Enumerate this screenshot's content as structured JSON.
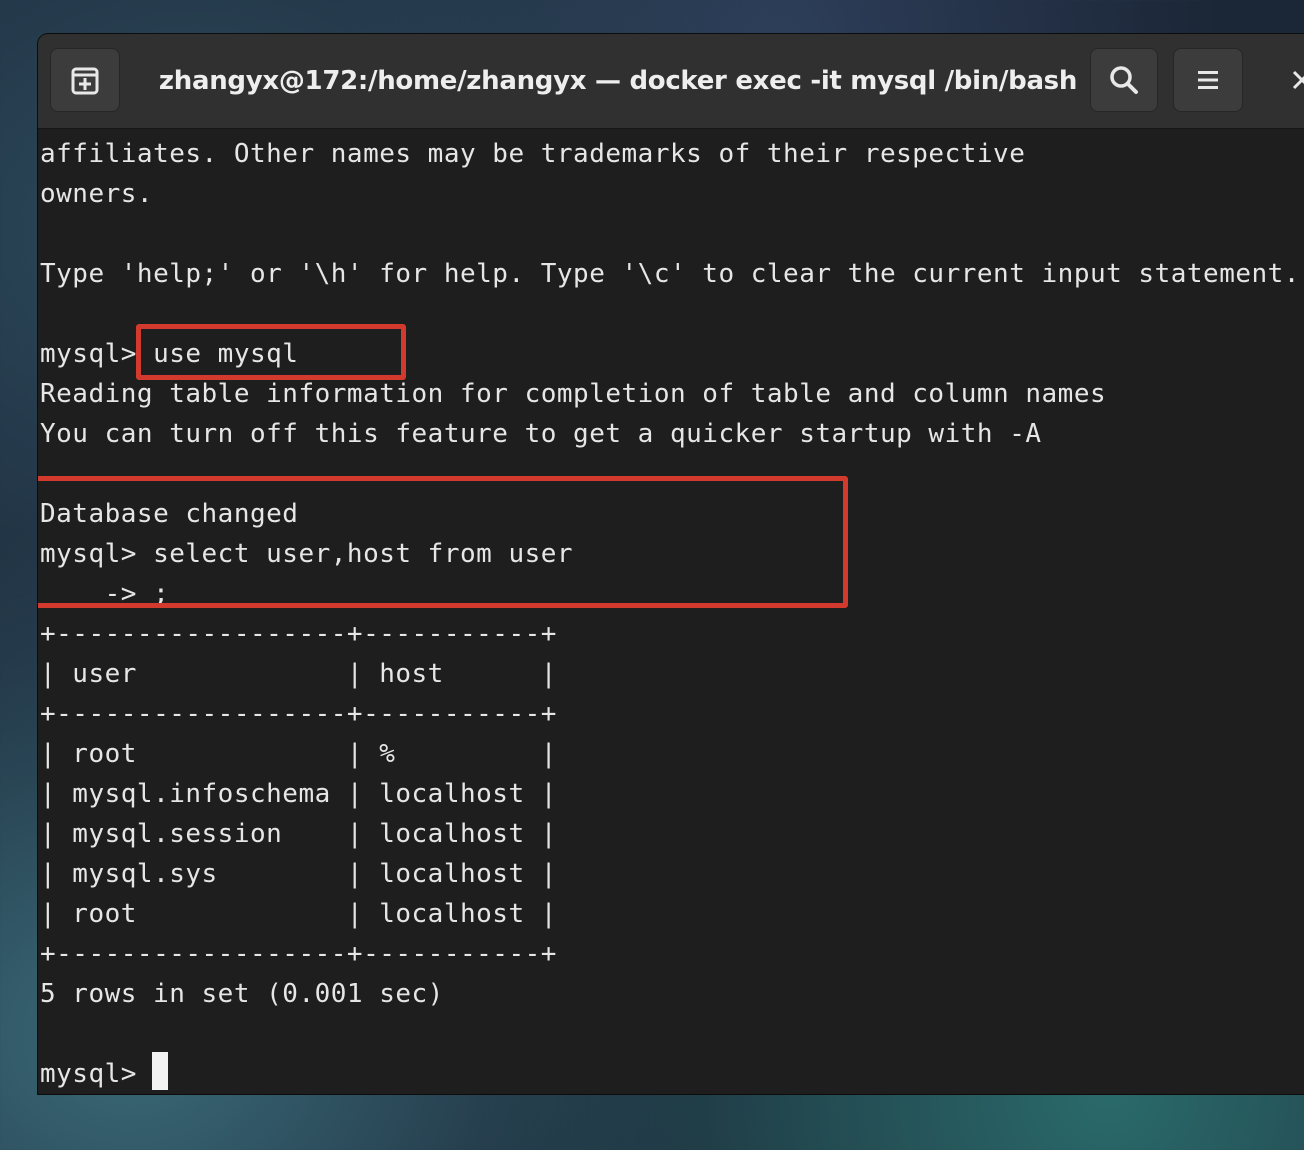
{
  "window": {
    "title": "zhangyx@172:/home/zhangyx — docker exec -it mysql /bin/bash"
  },
  "titlebar": {
    "new_tab_icon": "new-tab-icon",
    "search_icon": "search-icon",
    "menu_icon": "hamburger-menu-icon",
    "close_icon": "close-icon"
  },
  "terminal": {
    "lines": [
      "affiliates. Other names may be trademarks of their respective",
      "owners.",
      "",
      "Type 'help;' or '\\h' for help. Type '\\c' to clear the current input statement.",
      "",
      "mysql> use mysql",
      "Reading table information for completion of table and column names",
      "You can turn off this feature to get a quicker startup with -A",
      "",
      "Database changed",
      "mysql> select user,host from user",
      "    -> ;",
      "+------------------+-----------+",
      "| user             | host      |",
      "+------------------+-----------+",
      "| root             | %         |",
      "| mysql.infoschema | localhost |",
      "| mysql.session    | localhost |",
      "| mysql.sys        | localhost |",
      "| root             | localhost |",
      "+------------------+-----------+",
      "5 rows in set (0.001 sec)",
      "",
      "mysql> "
    ]
  },
  "annotation_color": "#d13a2c"
}
